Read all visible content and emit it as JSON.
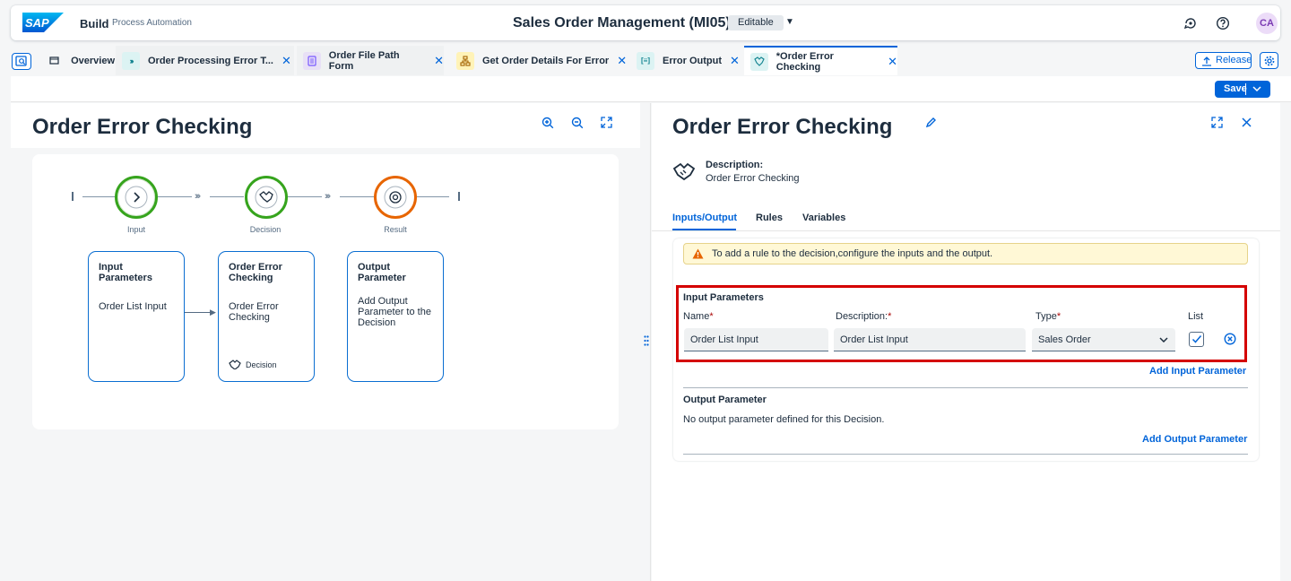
{
  "shell": {
    "logo": "SAP",
    "product": "Build",
    "subproduct": "Process Automation",
    "title": "Sales Order Management (MI05)",
    "status": "Editable",
    "avatar": "CA",
    "icons": [
      "feedback-icon",
      "help-icon"
    ]
  },
  "tabs": [
    {
      "label": "Overview",
      "icon": "overview-icon",
      "active": false
    },
    {
      "label": "Order Processing Error T...",
      "icon": "process-icon",
      "color": "#dcf3f3",
      "active": false
    },
    {
      "label": "Order File Path Form",
      "icon": "form-icon",
      "color": "#e8e0f6",
      "active": false
    },
    {
      "label": "Get Order Details For Error",
      "icon": "automation-icon",
      "color": "#fff3b8",
      "active": false
    },
    {
      "label": "Error Output",
      "icon": "output-icon",
      "color": "#dcf3f3",
      "active": false
    },
    {
      "label": "*Order Error Checking",
      "icon": "decision-icon",
      "color": "#dcf3f3",
      "active": true
    }
  ],
  "toolbar": {
    "release_label": "Release",
    "save_label": "Save"
  },
  "canvas": {
    "title": "Order Error Checking",
    "nodes": [
      {
        "label": "Input",
        "color": "#36a41d"
      },
      {
        "label": "Decision",
        "color": "#36a41d"
      },
      {
        "label": "Result",
        "color": "#e76500"
      }
    ],
    "cards": [
      {
        "title": "Input Parameters",
        "body": "Order List Input"
      },
      {
        "title": "Order Error Checking",
        "body": "Order Error Checking",
        "footer": "Decision"
      },
      {
        "title": "Output Parameter",
        "body": "Add Output Parameter to the Decision"
      }
    ]
  },
  "detail": {
    "title": "Order Error Checking",
    "description_label": "Description:",
    "description_value": "Order Error Checking",
    "tabs": [
      "Inputs/Output",
      "Rules",
      "Variables"
    ],
    "warning": "To add a rule to the decision,configure the inputs and the output.",
    "input_section": "Input Parameters",
    "labels": {
      "name": "Name",
      "description": "Description:",
      "type": "Type",
      "list": "List"
    },
    "row": {
      "name": "Order List Input",
      "description": "Order List Input",
      "type": "Sales Order",
      "list_checked": true
    },
    "add_input": "Add Input Parameter",
    "output_section": "Output Parameter",
    "output_empty": "No output parameter defined for this Decision.",
    "add_output": "Add Output Parameter"
  }
}
